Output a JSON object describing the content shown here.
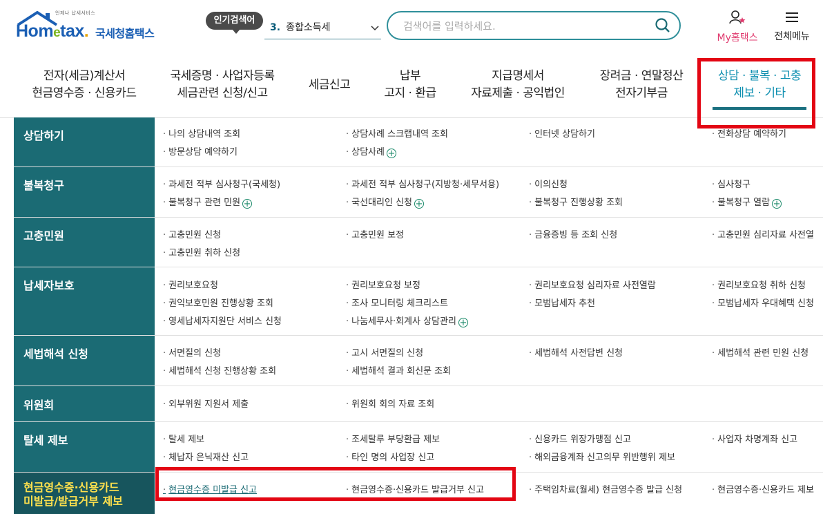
{
  "logo": {
    "sub": "언제나 납세서비스",
    "word_a": "Hom",
    "word_e": "e",
    "word_b": "tax",
    "korean": "국세청홈택스"
  },
  "popular": {
    "badge": "인기검색어",
    "rank": "3.",
    "keyword": "종합소득세"
  },
  "search": {
    "placeholder": "검색어를 입력하세요."
  },
  "util": {
    "my": "My홈택스",
    "all": "전체메뉴"
  },
  "nav": [
    {
      "line1": "전자(세금)계산서",
      "line2": "현금영수증 · 신용카드"
    },
    {
      "line1": "국세증명 · 사업자등록",
      "line2": "세금관련 신청/신고"
    },
    {
      "line1": "세금신고",
      "line2": ""
    },
    {
      "line1": "납부",
      "line2": "고지 · 환급"
    },
    {
      "line1": "지급명세서",
      "line2": "자료제출 · 공익법인"
    },
    {
      "line1": "장려금 · 연말정산",
      "line2": "전자기부금"
    },
    {
      "line1": "상담 · 불복 · 고충",
      "line2": "제보 · 기타"
    }
  ],
  "colors": {
    "teal": "#1b6b74",
    "highlight": "#e30613",
    "yellow": "#ffe14d"
  },
  "rows": [
    {
      "cat": "상담하기",
      "links": [
        "나의 상담내역 조회",
        "상담사례 스크랩내역 조회",
        "인터넷 상담하기",
        "전화상담 예약하기",
        "방문상담 예약하기",
        "상담사례"
      ]
    },
    {
      "cat": "불복청구",
      "links": [
        "과세전 적부 심사청구(국세청)",
        "과세전 적부 심사청구(지방청·세무서용)",
        "이의신청",
        "심사청구",
        "불복청구 관련 민원",
        "국선대리인 신청",
        "불복청구 진행상황 조회",
        "불복청구 열람"
      ]
    },
    {
      "cat": "고충민원",
      "links": [
        "고충민원 신청",
        "고충민원 보정",
        "금융증빙 등 조회 신청",
        "고충민원 심리자료 사전열",
        "고충민원 취하 신청"
      ]
    },
    {
      "cat": "납세자보호",
      "links": [
        "권리보호요청",
        "권리보호요청 보정",
        "권리보호요청 심리자료 사전열람",
        "권리보호요청 취하 신청",
        "권익보호민원 진행상황 조회",
        "조사 모니터링 체크리스트",
        "모범납세자 추천",
        "모범납세자 우대혜택 신청",
        "영세납세자지원단 서비스 신청",
        "나눔세무사·회계사 상담관리"
      ]
    },
    {
      "cat": "세법해석 신청",
      "links": [
        "서면질의 신청",
        "고시 서면질의 신청",
        "세법해석 사전답변 신청",
        "세법해석 관련 민원 신청",
        "세법해석 신청 진행상황 조회",
        "세법해석 결과 회신문 조회"
      ]
    },
    {
      "cat": "위원회",
      "links": [
        "외부위원 지원서 제출",
        "위원회 회의 자료 조회"
      ]
    },
    {
      "cat": "탈세 제보",
      "links": [
        "탈세 제보",
        "조세탈루 부당환급 제보",
        "신용카드 위장가맹점 신고",
        "사업자 차명계좌 신고",
        "체납자 은닉재산 신고",
        "타인 명의 사업장 신고",
        "해외금융계좌 신고의무 위반행위 제보"
      ]
    },
    {
      "cat_line1": "현금영수증·신용카드",
      "cat_line2": "미발급/발급거부 제보",
      "links": [
        "현금영수증 미발급 신고",
        "현금영수증·신용카드 발급거부 신고",
        "주택임차료(월세) 현금영수증 발급 신청",
        "현금영수증·신용카드 제보"
      ]
    }
  ]
}
